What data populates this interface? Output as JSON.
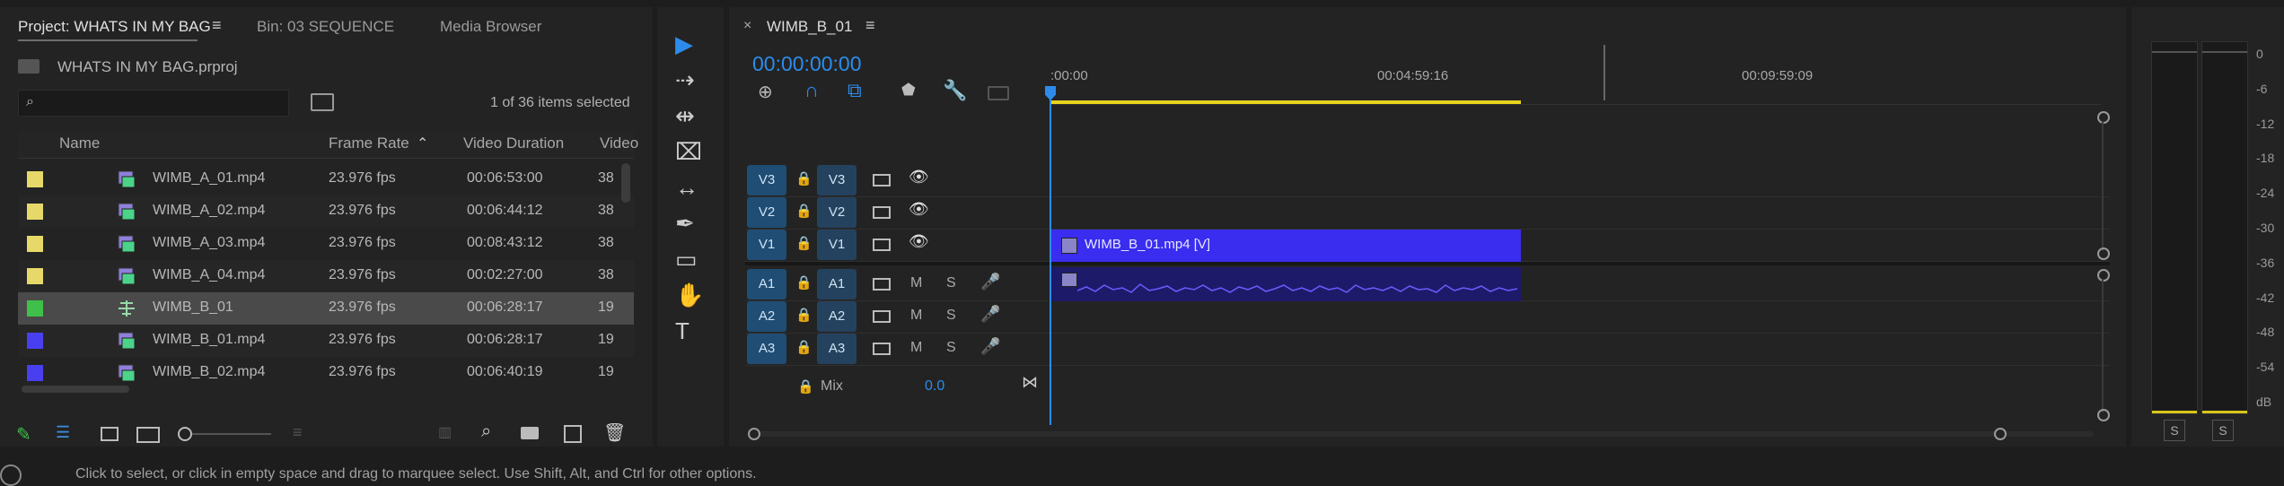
{
  "project_panel": {
    "tabs": [
      "Project: WHATS IN MY BAG",
      "Bin: 03 SEQUENCE",
      "Media Browser"
    ],
    "project_file": "WHATS IN MY BAG.prproj",
    "search_placeholder": "",
    "selection_status": "1 of 36 items selected",
    "columns": [
      "Name",
      "Frame Rate",
      "Video Duration",
      "Video"
    ],
    "items": [
      {
        "name": "WIMB_A_01.mp4",
        "frame_rate": "23.976 fps",
        "duration": "00:06:53:00",
        "video": "38",
        "color": "#e6d96a",
        "type": "clip"
      },
      {
        "name": "WIMB_A_02.mp4",
        "frame_rate": "23.976 fps",
        "duration": "00:06:44:12",
        "video": "38",
        "color": "#e6d96a",
        "type": "clip"
      },
      {
        "name": "WIMB_A_03.mp4",
        "frame_rate": "23.976 fps",
        "duration": "00:08:43:12",
        "video": "38",
        "color": "#e6d96a",
        "type": "clip"
      },
      {
        "name": "WIMB_A_04.mp4",
        "frame_rate": "23.976 fps",
        "duration": "00:02:27:00",
        "video": "38",
        "color": "#e6d96a",
        "type": "clip"
      },
      {
        "name": "WIMB_B_01",
        "frame_rate": "23.976 fps",
        "duration": "00:06:28:17",
        "video": "19",
        "color": "#3fc04a",
        "type": "sequence"
      },
      {
        "name": "WIMB_B_01.mp4",
        "frame_rate": "23.976 fps",
        "duration": "00:06:28:17",
        "video": "19",
        "color": "#4a3ff0",
        "type": "clip"
      },
      {
        "name": "WIMB_B_02.mp4",
        "frame_rate": "23.976 fps",
        "duration": "00:06:40:19",
        "video": "19",
        "color": "#4a3ff0",
        "type": "clip"
      }
    ],
    "selected_index": 4
  },
  "timeline": {
    "tab_title": "WIMB_B_01",
    "timecode": "00:00:00:00",
    "ruler_labels": [
      ":00:00",
      "00:04:59:16",
      "00:09:59:09"
    ],
    "video_tracks": [
      {
        "source": "V3",
        "target": "V3"
      },
      {
        "source": "V2",
        "target": "V2"
      },
      {
        "source": "V1",
        "target": "V1"
      }
    ],
    "audio_tracks": [
      {
        "source": "A1",
        "target": "A1"
      },
      {
        "source": "A2",
        "target": "A2"
      },
      {
        "source": "A3",
        "target": "A3"
      }
    ],
    "mute_label": "M",
    "solo_label": "S",
    "mix_label": "Mix",
    "mix_value": "0.0",
    "video_clip_label": "WIMB_B_01.mp4 [V]",
    "work_area_color": "#e8d41c",
    "clip_color": "#3a2df0",
    "playhead_color": "#2d8ceb"
  },
  "meter": {
    "scale": [
      "0",
      "-6",
      "-12",
      "-18",
      "-24",
      "-30",
      "-36",
      "-42",
      "-48",
      "-54",
      "dB"
    ],
    "solo_buttons": [
      "S",
      "S"
    ]
  },
  "status_bar": {
    "hint": "Click to select, or click in empty space and drag to marquee select. Use Shift, Alt, and Ctrl for other options."
  },
  "tools": [
    "selection-tool",
    "track-select-tool",
    "ripple-edit-tool",
    "razor-tool",
    "slip-tool",
    "pen-tool",
    "rectangle-tool",
    "hand-tool",
    "type-tool"
  ]
}
